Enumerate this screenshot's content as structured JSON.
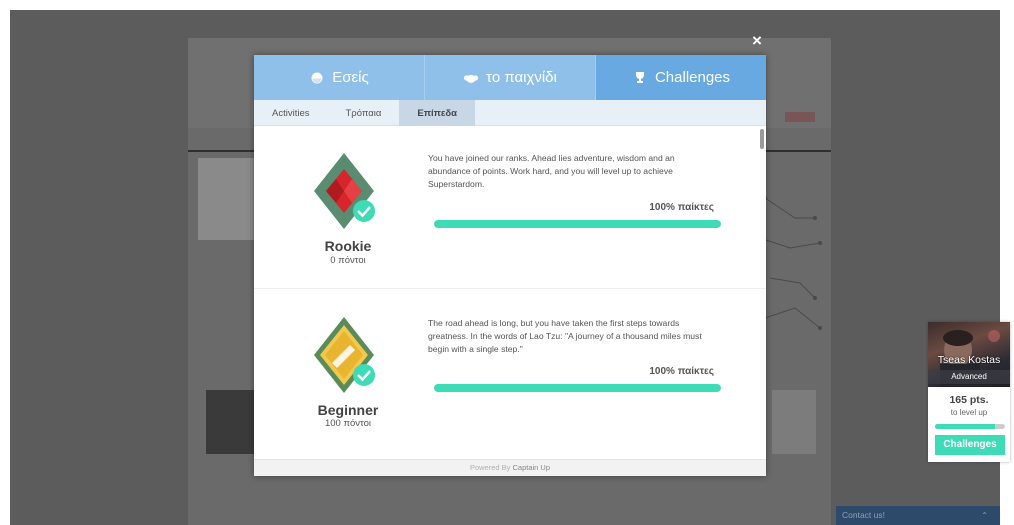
{
  "modal": {
    "close_label": "×",
    "main_tabs": [
      {
        "label": "Εσείς",
        "icon": "user-icon",
        "active": false
      },
      {
        "label": "το παιχνίδι",
        "icon": "group-icon",
        "active": false
      },
      {
        "label": "Challenges",
        "icon": "trophy-icon",
        "active": true
      }
    ],
    "sub_tabs": [
      {
        "label": "Activities",
        "active": false
      },
      {
        "label": "Τρόπαια",
        "active": false
      },
      {
        "label": "Επίπεδα",
        "active": true
      }
    ],
    "levels": [
      {
        "name": "Rookie",
        "points": "0 πόντοι",
        "description": "You have joined our ranks. Ahead lies adventure, wisdom and an abundance of points. Work hard, and you will level up to achieve Superstardom.",
        "percent_label": "100% παίκτες",
        "progress": 1.0,
        "badge_colors": {
          "main": "#d6262b",
          "accent": "#5a8c72",
          "check": "#3ddbb6"
        }
      },
      {
        "name": "Beginner",
        "points": "100 πόντοι",
        "description": "The road ahead is long, but you have taken the first steps towards greatness. In the words of Lao Tzu: \"A journey of a thousand miles must begin with a single step.\"",
        "percent_label": "100% παίκτες",
        "progress": 1.0,
        "badge_colors": {
          "main": "#f2c94c",
          "accent": "#5a8c5a",
          "check": "#3ddbb6"
        }
      }
    ],
    "powered_prefix": "Powered By",
    "powered_brand": "Captain Up"
  },
  "profile": {
    "name": "Tseas Kostas",
    "rank": "Advanced",
    "points": "165 pts.",
    "to_level": "to level up",
    "progress": 0.85,
    "button_label": "Challenges"
  },
  "contact": {
    "label": "Contact us!",
    "chevron": "⌃"
  },
  "colors": {
    "accent_teal": "#3ddbb6",
    "tab_blue": "#8fc0ea",
    "tab_blue_active": "#67a9e0"
  }
}
